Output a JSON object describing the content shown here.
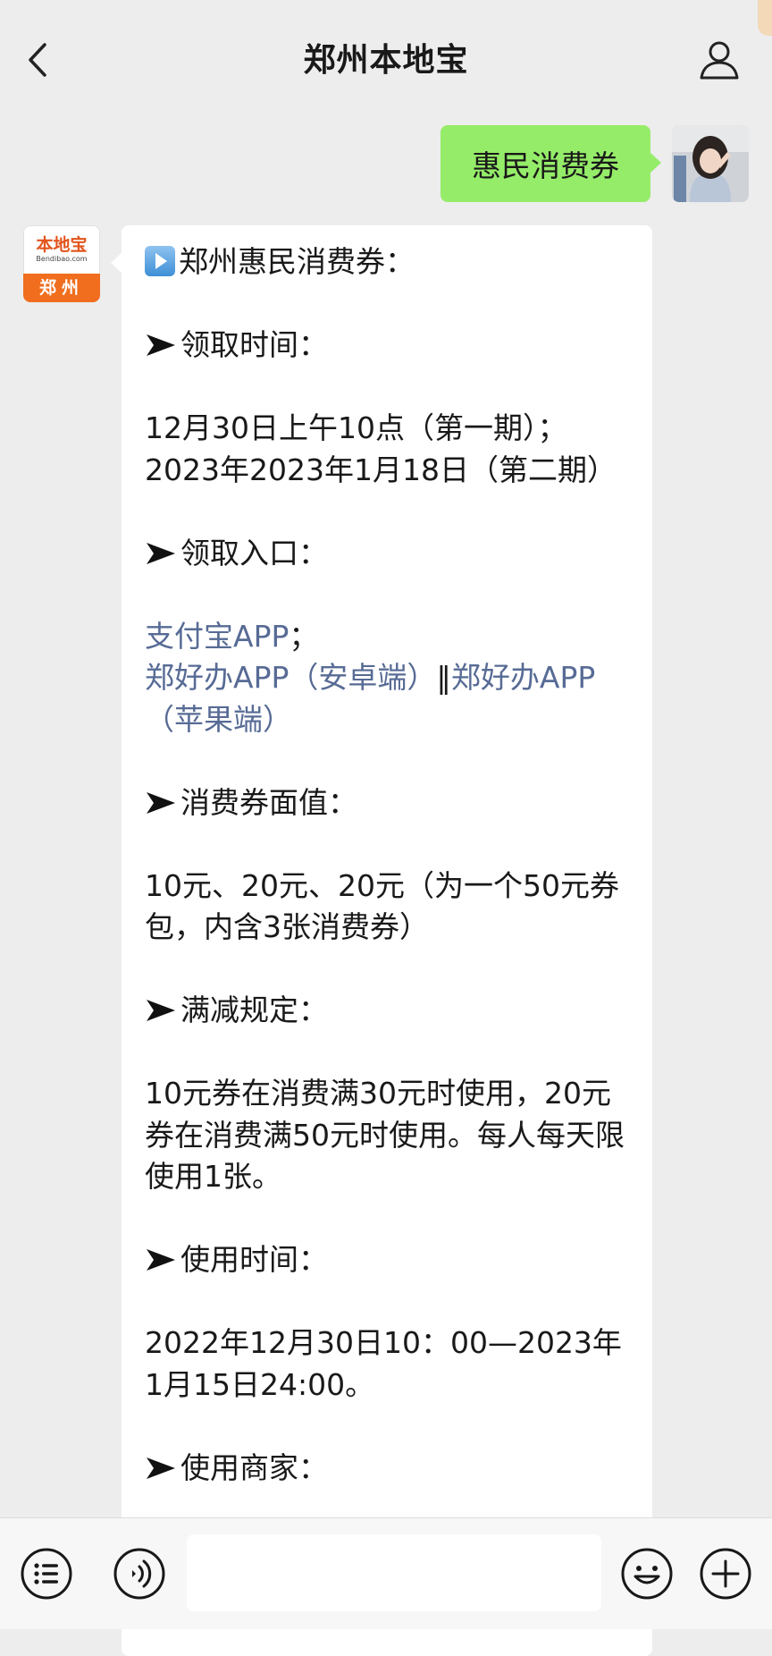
{
  "header": {
    "title": "郑州本地宝",
    "back_icon": "chevron-left-icon",
    "profile_icon": "person-icon"
  },
  "outgoing_message": {
    "text": "惠民消费券",
    "bubble_color": "#95ec69"
  },
  "bot_avatar": {
    "logo_text": "本地宝",
    "logo_domain": "Bendibao.com",
    "logo_city": "郑州",
    "accent_color": "#f06e1e"
  },
  "incoming_message": {
    "heading": "郑州惠民消费券：",
    "sections": {
      "claim_time_label": "领取时间：",
      "claim_time_line1": "12月30日上午10点（第一期）；",
      "claim_time_line2": "2023年2023年1月18日（第二期）",
      "claim_entry_label": "领取入口：",
      "entry_alipay": "支付宝APP",
      "entry_alipay_suffix": "；",
      "entry_zhb_android": "郑好办APP（安卓端）",
      "entry_separator": "‖",
      "entry_zhb_ios": "郑好办APP（苹果端）",
      "value_label": "消费券面值：",
      "value_text": "10元、20元、20元（为一个50元券包，内含3张消费券）",
      "rule_label": "满减规定：",
      "rule_text": "10元券在消费满30元时使用，20元券在消费满50元时使用。每人每天限使用1张。",
      "use_time_label": "使用时间：",
      "use_time_text": "2022年12月30日10：00—2023年1月15日24:00。",
      "next_label": "使用商家："
    },
    "link_color": "#576b95"
  },
  "bottom_bar": {
    "menu_icon": "list-menu-icon",
    "voice_icon": "voice-icon",
    "emoji_icon": "emoji-icon",
    "plus_icon": "plus-icon",
    "input_value": ""
  }
}
